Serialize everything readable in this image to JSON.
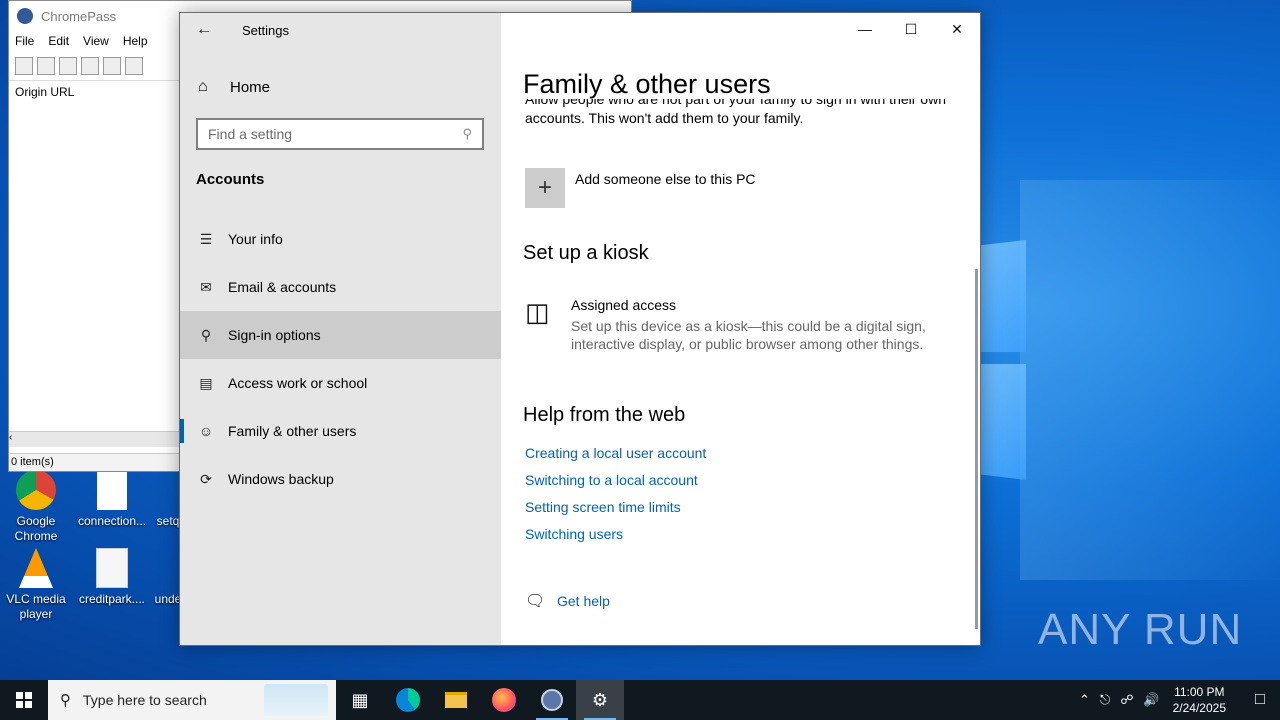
{
  "desktop": {
    "watermark": "ANY RUN",
    "icons": [
      {
        "label": "Google Chrome"
      },
      {
        "label": "connection..."
      },
      {
        "label": "setq"
      },
      {
        "label": "VLC media player"
      },
      {
        "label": "creditpark...."
      },
      {
        "label": "unde"
      }
    ]
  },
  "chromepass": {
    "title": "ChromePass",
    "menu": [
      "File",
      "Edit",
      "View",
      "Help"
    ],
    "column_header": "Origin URL",
    "status": "0 item(s)"
  },
  "settings": {
    "window_title": "Settings",
    "home_label": "Home",
    "search_placeholder": "Find a setting",
    "section": "Accounts",
    "nav": [
      {
        "label": "Your info",
        "icon": "person-card-icon"
      },
      {
        "label": "Email & accounts",
        "icon": "mail-icon"
      },
      {
        "label": "Sign-in options",
        "icon": "key-icon"
      },
      {
        "label": "Access work or school",
        "icon": "briefcase-icon"
      },
      {
        "label": "Family & other users",
        "icon": "person-icon"
      },
      {
        "label": "Windows backup",
        "icon": "sync-icon"
      }
    ],
    "content": {
      "page_title": "Family & other users",
      "clipped_line": "Allow people who are not part of your family to sign in with their own",
      "desc_line": "accounts. This won't add them to your family.",
      "add_label": "Add someone else to this PC",
      "kiosk_heading": "Set up a kiosk",
      "kiosk_title": "Assigned access",
      "kiosk_desc": "Set up this device as a kiosk—this could be a digital sign, interactive display, or public browser among other things.",
      "help_heading": "Help from the web",
      "links": [
        "Creating a local user account",
        "Switching to a local account",
        "Setting screen time limits",
        "Switching users"
      ],
      "get_help": "Get help"
    }
  },
  "taskbar": {
    "search_placeholder": "Type here to search",
    "time": "11:00 PM",
    "date": "2/24/2025"
  }
}
